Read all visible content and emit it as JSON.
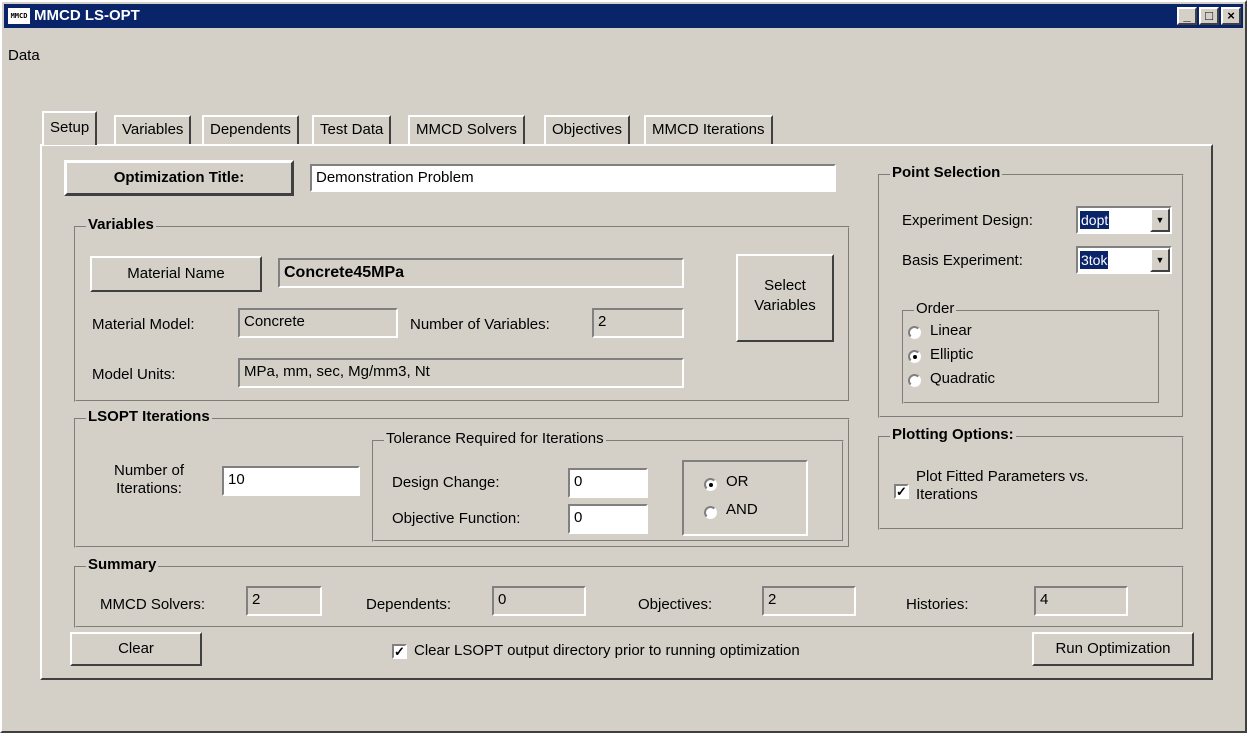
{
  "window": {
    "title": "MMCD LS-OPT",
    "app_icon_text": "MMCD",
    "minimize": "_",
    "maximize": "□",
    "close": "×"
  },
  "menu": {
    "data": "Data"
  },
  "tabs": [
    "Setup",
    "Variables",
    "Dependents",
    "Test Data",
    "MMCD Solvers",
    "Objectives",
    "MMCD Iterations"
  ],
  "setup": {
    "optimization_title_button": "Optimization Title:",
    "optimization_title_value": "Demonstration Problem",
    "variables": {
      "caption": "Variables",
      "material_name_button": "Material Name",
      "material_name_value": "Concrete45MPa",
      "material_model_label": "Material Model:",
      "material_model_value": "Concrete",
      "num_variables_label": "Number of Variables:",
      "num_variables_value": "2",
      "model_units_label": "Model Units:",
      "model_units_value": "MPa, mm, sec, Mg/mm3, Nt",
      "select_variables_line1": "Select",
      "select_variables_line2": "Variables"
    },
    "lsopt": {
      "caption": "LSOPT Iterations",
      "num_iterations_line1": "Number of",
      "num_iterations_line2": "Iterations:",
      "num_iterations_value": "10",
      "tolerance_caption": "Tolerance Required for Iterations",
      "design_change_label": "Design Change:",
      "design_change_value": "0",
      "objective_function_label": "Objective Function:",
      "objective_function_value": "0",
      "or_label": "OR",
      "and_label": "AND",
      "logic_selected": "OR"
    },
    "point_selection": {
      "caption": "Point Selection",
      "experiment_design_label": "Experiment Design:",
      "experiment_design_value": "dopt",
      "basis_experiment_label": "Basis Experiment:",
      "basis_experiment_value": "3tok",
      "order_caption": "Order",
      "order_options": [
        "Linear",
        "Elliptic",
        "Quadratic"
      ],
      "order_selected": "Elliptic"
    },
    "plotting": {
      "caption": "Plotting Options:",
      "plot_fitted_line1": "Plot Fitted Parameters vs.",
      "plot_fitted_line2": "Iterations",
      "plot_fitted_checked": true
    },
    "summary": {
      "caption": "Summary",
      "mmcd_solvers_label": "MMCD Solvers:",
      "mmcd_solvers_value": "2",
      "dependents_label": "Dependents:",
      "dependents_value": "0",
      "objectives_label": "Objectives:",
      "objectives_value": "2",
      "histories_label": "Histories:",
      "histories_value": "4"
    },
    "clear_button": "Clear",
    "clear_dir_label": "Clear LSOPT output directory prior to running optimization",
    "clear_dir_checked": true,
    "run_button": "Run Optimization",
    "check_mark": "✓"
  }
}
